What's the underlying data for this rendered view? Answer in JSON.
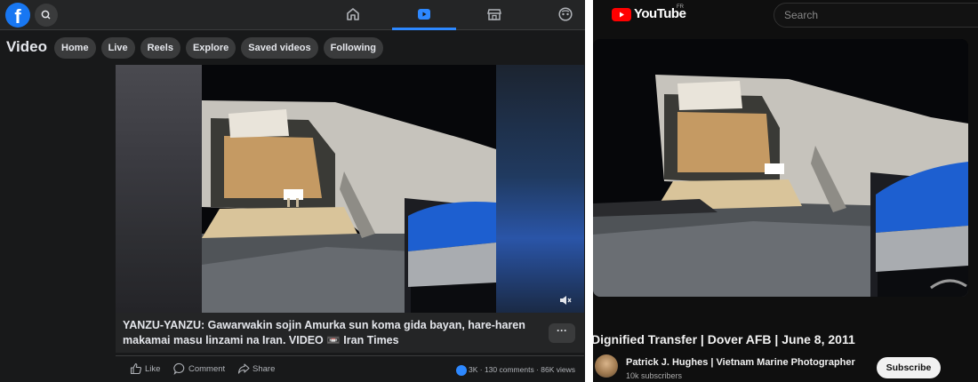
{
  "facebook": {
    "logo": "f",
    "nav_icons": [
      "home-icon",
      "video-icon",
      "marketplace-icon",
      "gaming-icon"
    ],
    "section_title": "Video",
    "tabs": [
      "Home",
      "Live",
      "Reels",
      "Explore",
      "Saved videos",
      "Following"
    ],
    "caption": "YANZU-YANZU: Gawarwakin sojin Amurka sun koma gida bayan, hare-haren makamai masu linzami na Iran. VIDEO 📼 Iran Times",
    "more_label": "···",
    "actions": {
      "like": "Like",
      "comment": "Comment",
      "share": "Share"
    },
    "stats": "3K · 130 comments · 86K views",
    "accent": "#1877f2"
  },
  "youtube": {
    "wordmark": "YouTube",
    "region": "FR",
    "search_placeholder": "Search",
    "video_title": "Dignified Transfer | Dover AFB | June 8, 2011",
    "channel": "Patrick J. Hughes | Vietnam Marine Photographer",
    "subscribers": "10k subscribers",
    "subscribe_label": "Subscribe",
    "accent": "#ff0000"
  }
}
